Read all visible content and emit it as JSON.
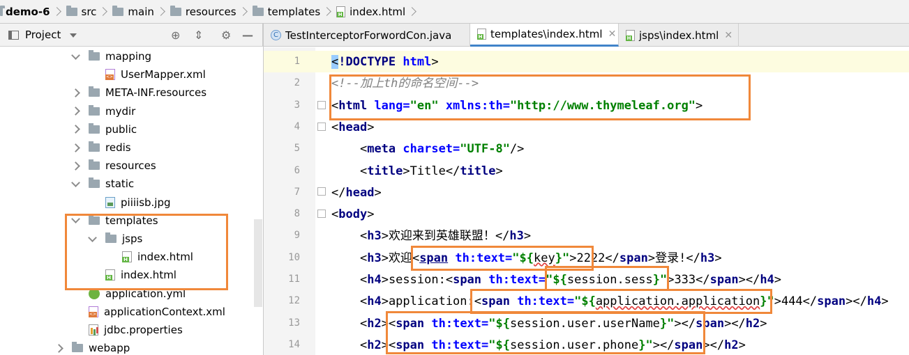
{
  "breadcrumb": [
    "demo-6",
    "src",
    "main",
    "resources",
    "templates",
    "index.html"
  ],
  "project_panel": {
    "title": "Project"
  },
  "tree": [
    {
      "label": "mapping",
      "level": 0,
      "state": "expanded",
      "icon": "folder"
    },
    {
      "label": "UserMapper.xml",
      "level": 1,
      "state": "none",
      "icon": "xml-file"
    },
    {
      "label": "META-INF.resources",
      "level": 0,
      "state": "collapsed",
      "icon": "folder"
    },
    {
      "label": "mydir",
      "level": 0,
      "state": "collapsed",
      "icon": "folder"
    },
    {
      "label": "public",
      "level": 0,
      "state": "collapsed",
      "icon": "folder"
    },
    {
      "label": "redis",
      "level": 0,
      "state": "collapsed",
      "icon": "folder"
    },
    {
      "label": "resources",
      "level": 0,
      "state": "collapsed",
      "icon": "folder"
    },
    {
      "label": "static",
      "level": 0,
      "state": "expanded",
      "icon": "folder"
    },
    {
      "label": "piiiisb.jpg",
      "level": 1,
      "state": "none",
      "icon": "image-file"
    },
    {
      "label": "templates",
      "level": 0,
      "state": "expanded",
      "icon": "folder"
    },
    {
      "label": "jsps",
      "level": 1,
      "state": "expanded",
      "icon": "folder"
    },
    {
      "label": "index.html",
      "level": 2,
      "state": "none",
      "icon": "html-file"
    },
    {
      "label": "index.html",
      "level": 1,
      "state": "none",
      "icon": "html-file"
    },
    {
      "label": "application.yml",
      "level": 0,
      "state": "none",
      "icon": "yml-file"
    },
    {
      "label": "applicationContext.xml",
      "level": 0,
      "state": "none",
      "icon": "xml-file"
    },
    {
      "label": "jdbc.properties",
      "level": 0,
      "state": "none",
      "icon": "properties-file"
    },
    {
      "label": "webapp",
      "level": -1,
      "state": "collapsed",
      "icon": "folder"
    }
  ],
  "tabs": [
    {
      "label": "TestInterceptorForwordCon.java",
      "active": false,
      "icon": "class-icon"
    },
    {
      "label": "templates\\index.html",
      "active": true,
      "icon": "html-icon"
    },
    {
      "label": "jsps\\index.html",
      "active": false,
      "icon": "html-icon"
    }
  ],
  "line_numbers": [
    "1",
    "2",
    "3",
    "4",
    "5",
    "6",
    "7",
    "8",
    "9",
    "10",
    "11",
    "12",
    "13",
    "14"
  ],
  "code": [
    [
      [
        "br-hl",
        "<"
      ],
      [
        "tg",
        "!DOCTYPE "
      ],
      [
        "at",
        "html"
      ],
      [
        "br",
        ">"
      ]
    ],
    [
      [
        "cm",
        "<!--加上th的命名空间-->"
      ]
    ],
    [
      [
        "br",
        "<"
      ],
      [
        "tg",
        "html "
      ],
      [
        "at",
        "lang="
      ],
      [
        "st",
        "\"en\" "
      ],
      [
        "at",
        "xmlns:th="
      ],
      [
        "st",
        "\"http://www.thymeleaf.org\""
      ],
      [
        "br",
        ">"
      ]
    ],
    [
      [
        "br",
        "<"
      ],
      [
        "tg",
        "head"
      ],
      [
        "br",
        ">"
      ]
    ],
    [
      [
        "tx",
        "    "
      ],
      [
        "br",
        "<"
      ],
      [
        "tg",
        "meta "
      ],
      [
        "at",
        "charset="
      ],
      [
        "st",
        "\"UTF-8\""
      ],
      [
        "br",
        "/>"
      ]
    ],
    [
      [
        "tx",
        "    "
      ],
      [
        "br",
        "<"
      ],
      [
        "tg",
        "title"
      ],
      [
        "br",
        ">"
      ],
      [
        "tx",
        "Title"
      ],
      [
        "br",
        "</"
      ],
      [
        "tg",
        "title"
      ],
      [
        "br",
        ">"
      ]
    ],
    [
      [
        "br",
        "</"
      ],
      [
        "tg",
        "head"
      ],
      [
        "br",
        ">"
      ]
    ],
    [
      [
        "br",
        "<"
      ],
      [
        "tg",
        "body"
      ],
      [
        "br",
        ">"
      ]
    ],
    [
      [
        "tx",
        "    "
      ],
      [
        "br",
        "<"
      ],
      [
        "tg",
        "h3"
      ],
      [
        "br",
        ">"
      ],
      [
        "tx",
        "欢迎来到英雄联盟！"
      ],
      [
        "br",
        "</"
      ],
      [
        "tg",
        "h3"
      ],
      [
        "br",
        ">"
      ]
    ],
    [
      [
        "tx",
        "    "
      ],
      [
        "br",
        "<"
      ],
      [
        "tg",
        "h3"
      ],
      [
        "br",
        ">"
      ],
      [
        "tx",
        "欢迎"
      ],
      [
        "br",
        "<"
      ],
      [
        "tg-ul",
        "span"
      ],
      [
        "tg",
        " "
      ],
      [
        "at",
        "th:text="
      ],
      [
        "st",
        "\"${"
      ],
      [
        "tx-sq",
        "key"
      ],
      [
        "st",
        "}\""
      ],
      [
        "br",
        ">"
      ],
      [
        "tx",
        "2222"
      ],
      [
        "br",
        "</"
      ],
      [
        "tg",
        "span"
      ],
      [
        "br",
        ">"
      ],
      [
        "tx",
        "登录!"
      ],
      [
        "br",
        "</"
      ],
      [
        "tg",
        "h3"
      ],
      [
        "br",
        ">"
      ]
    ],
    [
      [
        "tx",
        "    "
      ],
      [
        "br",
        "<"
      ],
      [
        "tg",
        "h4"
      ],
      [
        "br",
        ">"
      ],
      [
        "tx",
        "session:"
      ],
      [
        "br",
        "<"
      ],
      [
        "tg",
        "span "
      ],
      [
        "at",
        "th:text="
      ],
      [
        "st",
        "\"${"
      ],
      [
        "tx",
        "session.sess"
      ],
      [
        "st",
        "}\""
      ],
      [
        "br",
        ">"
      ],
      [
        "tx",
        "333"
      ],
      [
        "br",
        "</"
      ],
      [
        "tg",
        "span"
      ],
      [
        "br",
        "></"
      ],
      [
        "tg",
        "h4"
      ],
      [
        "br",
        ">"
      ]
    ],
    [
      [
        "tx",
        "    "
      ],
      [
        "br",
        "<"
      ],
      [
        "tg",
        "h4"
      ],
      [
        "br",
        ">"
      ],
      [
        "tx",
        "application:"
      ],
      [
        "br",
        "<"
      ],
      [
        "tg",
        "span "
      ],
      [
        "at",
        "th:text="
      ],
      [
        "st",
        "\"${"
      ],
      [
        "tx-sq",
        "application.application"
      ],
      [
        "st",
        "}\""
      ],
      [
        "br",
        ">"
      ],
      [
        "tx",
        "444"
      ],
      [
        "br",
        "</"
      ],
      [
        "tg",
        "span"
      ],
      [
        "br",
        "></"
      ],
      [
        "tg",
        "h4"
      ],
      [
        "br",
        ">"
      ]
    ],
    [
      [
        "tx",
        "    "
      ],
      [
        "br",
        "<"
      ],
      [
        "tg",
        "h2"
      ],
      [
        "br",
        ">"
      ],
      [
        "br",
        "<"
      ],
      [
        "tg",
        "span "
      ],
      [
        "at",
        "th:text="
      ],
      [
        "st",
        "\"${"
      ],
      [
        "tx",
        "session.user.userName"
      ],
      [
        "st",
        "}\""
      ],
      [
        "br",
        "></"
      ],
      [
        "tg",
        "span"
      ],
      [
        "br",
        "></"
      ],
      [
        "tg",
        "h2"
      ],
      [
        "br",
        ">"
      ]
    ],
    [
      [
        "tx",
        "    "
      ],
      [
        "br",
        "<"
      ],
      [
        "tg",
        "h2"
      ],
      [
        "br",
        ">"
      ],
      [
        "br",
        "<"
      ],
      [
        "tg",
        "span "
      ],
      [
        "at",
        "th:text="
      ],
      [
        "st",
        "\"${"
      ],
      [
        "tx",
        "session.user.phone"
      ],
      [
        "st",
        "}\""
      ],
      [
        "br",
        "></"
      ],
      [
        "tg",
        "span"
      ],
      [
        "br",
        "></"
      ],
      [
        "tg",
        "h2"
      ],
      [
        "br",
        ">"
      ]
    ]
  ],
  "colors": {
    "highlight": "#f0883a",
    "tag": "#000080",
    "attr": "#0000ff",
    "string": "#008000",
    "comment": "#808080",
    "active_tab": "#4083c9"
  }
}
